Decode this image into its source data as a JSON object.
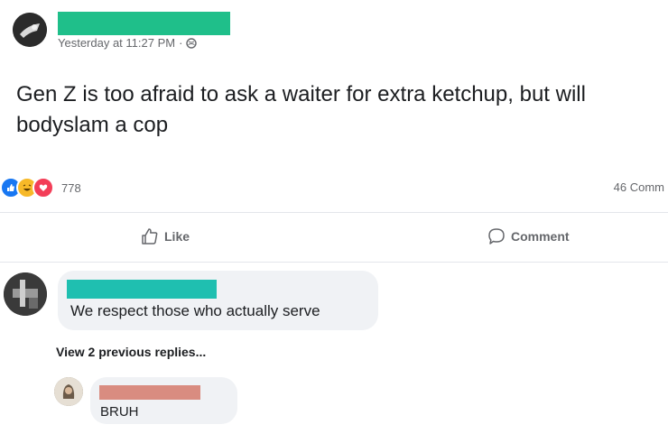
{
  "post": {
    "timestamp": "Yesterday at 11:27 PM",
    "separator": "·",
    "privacy_icon": "globe-icon",
    "text": "Gen Z is too afraid to ask a waiter for extra ketchup, but will bodyslam a cop",
    "reaction_icons": [
      "like-reaction-icon",
      "haha-reaction-icon",
      "love-reaction-icon"
    ],
    "reaction_count": "778",
    "comments_count": "46 Comm"
  },
  "actions": {
    "like_label": "Like",
    "comment_label": "Comment"
  },
  "comments": [
    {
      "text": "We respect those who actually serve"
    },
    {
      "text": "BRUH"
    }
  ],
  "view_replies_label": "View 2 previous replies...",
  "colors": {
    "redaction_name": "#1fbf8a",
    "redaction_comment_1": "#1fbfb0",
    "redaction_comment_2": "#d98c80",
    "muted_text": "#65676b",
    "like_blue": "#1877f2"
  }
}
